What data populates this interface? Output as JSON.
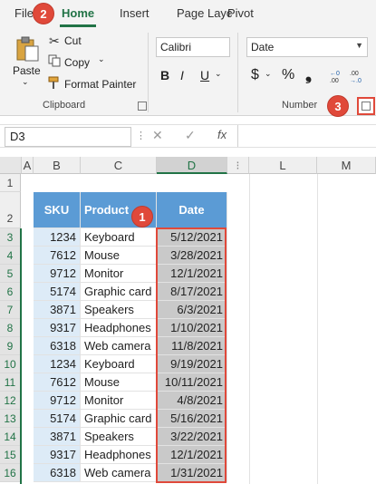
{
  "ribbon": {
    "tabs": [
      "File",
      "Home",
      "Insert",
      "Page Layc",
      "Pivot"
    ],
    "clipboard": {
      "paste_label": "Paste",
      "cut_label": "Cut",
      "copy_label": "Copy",
      "format_painter_label": "Format Painter",
      "group_label": "Clipboard"
    },
    "font": {
      "name": "Calibri",
      "bold": "B",
      "italic": "I",
      "underline": "U"
    },
    "number": {
      "format": "Date",
      "currency": "$",
      "percent": "%",
      "comma": "❟",
      "group_label": "Number"
    }
  },
  "formula_bar": {
    "name_box": "D3",
    "cancel": "✕",
    "enter": "✓",
    "fx": "fx"
  },
  "badges": [
    "1",
    "2",
    "3"
  ],
  "columns": [
    "A",
    "B",
    "C",
    "D",
    "L",
    "M"
  ],
  "row_numbers": [
    "1",
    "2",
    "3",
    "4",
    "5",
    "6",
    "7",
    "8",
    "9",
    "10",
    "11",
    "12",
    "13",
    "14",
    "15",
    "16"
  ],
  "table": {
    "headers": {
      "sku": "SKU",
      "product": "Product",
      "date": "Date"
    },
    "rows": [
      {
        "sku": "1234",
        "product": "Keyboard",
        "date": "5/12/2021"
      },
      {
        "sku": "7612",
        "product": "Mouse",
        "date": "3/28/2021"
      },
      {
        "sku": "9712",
        "product": "Monitor",
        "date": "12/1/2021"
      },
      {
        "sku": "5174",
        "product": "Graphic card",
        "date": "8/17/2021"
      },
      {
        "sku": "3871",
        "product": "Speakers",
        "date": "6/3/2021"
      },
      {
        "sku": "9317",
        "product": "Headphones",
        "date": "1/10/2021"
      },
      {
        "sku": "6318",
        "product": "Web camera",
        "date": "11/8/2021"
      },
      {
        "sku": "1234",
        "product": "Keyboard",
        "date": "9/19/2021"
      },
      {
        "sku": "7612",
        "product": "Mouse",
        "date": "10/11/2021"
      },
      {
        "sku": "9712",
        "product": "Monitor",
        "date": "4/8/2021"
      },
      {
        "sku": "5174",
        "product": "Graphic card",
        "date": "5/16/2021"
      },
      {
        "sku": "3871",
        "product": "Speakers",
        "date": "3/22/2021"
      },
      {
        "sku": "9317",
        "product": "Headphones",
        "date": "12/1/2021"
      },
      {
        "sku": "6318",
        "product": "Web camera",
        "date": "1/31/2021"
      }
    ]
  },
  "colors": {
    "accent": "#217346",
    "badge": "#e0493a",
    "header": "#5b9bd5",
    "sku_fill": "#ddebf7",
    "date_fill": "#c9c9c9",
    "highlight": "#e0493a"
  }
}
